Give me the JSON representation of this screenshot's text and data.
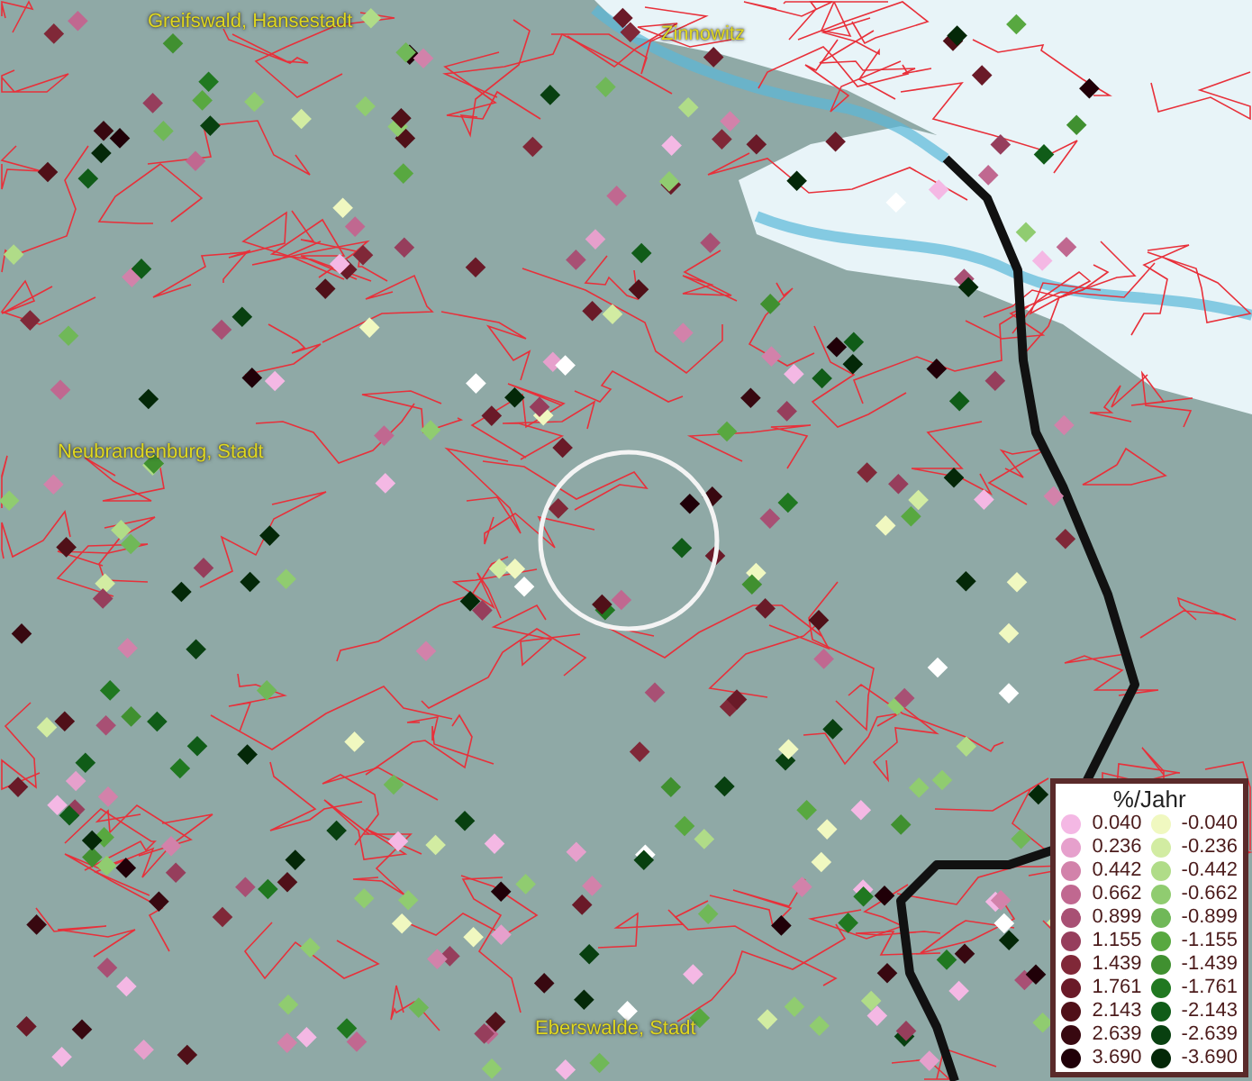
{
  "map": {
    "places": [
      {
        "label": "Greifswald, Hansestadt"
      },
      {
        "label": "Zinnowitz"
      },
      {
        "label": "Neubrandenburg, Stadt"
      },
      {
        "label": "Eberswalde, Stadt"
      }
    ]
  },
  "legend": {
    "title": "%/Jahr",
    "positive": [
      {
        "label": "0.040",
        "color": "#f4b8e4"
      },
      {
        "label": "0.236",
        "color": "#e6a0cc"
      },
      {
        "label": "0.442",
        "color": "#d282aa"
      },
      {
        "label": "0.662",
        "color": "#c06890"
      },
      {
        "label": "0.899",
        "color": "#a85074"
      },
      {
        "label": "1.155",
        "color": "#963e5c"
      },
      {
        "label": "1.439",
        "color": "#802838"
      },
      {
        "label": "1.761",
        "color": "#6a1a28"
      },
      {
        "label": "2.143",
        "color": "#501018"
      },
      {
        "label": "2.639",
        "color": "#380810"
      },
      {
        "label": "3.690",
        "color": "#200008"
      }
    ],
    "negative": [
      {
        "label": "-0.040",
        "color": "#f0f8c0"
      },
      {
        "label": "-0.236",
        "color": "#d2eca2"
      },
      {
        "label": "-0.442",
        "color": "#b0dc88"
      },
      {
        "label": "-0.662",
        "color": "#90cc70"
      },
      {
        "label": "-0.899",
        "color": "#70b858"
      },
      {
        "label": "-1.155",
        "color": "#58a840"
      },
      {
        "label": "-1.439",
        "color": "#409030"
      },
      {
        "label": "-1.761",
        "color": "#207820"
      },
      {
        "label": "-2.143",
        "color": "#105c18"
      },
      {
        "label": "-2.639",
        "color": "#084010"
      },
      {
        "label": "-3.690",
        "color": "#042808"
      }
    ]
  }
}
